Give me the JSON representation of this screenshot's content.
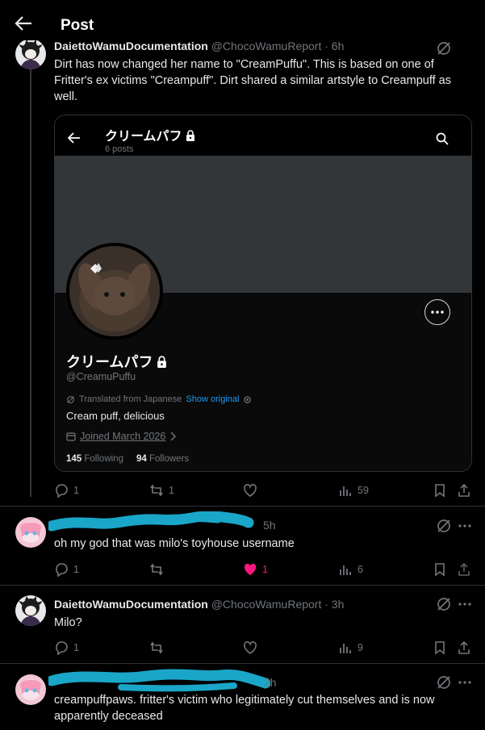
{
  "header": {
    "title": "Post"
  },
  "main_post": {
    "name": "DaiettoWamuDocumentation",
    "handle_time": "@ChocoWamuReport · 6h",
    "text": "Dirt has now changed her name to \"CreamPuffu\". This is based on one of Fritter's ex victims \"Creampuff\". Dirt shared a similar artstyle to Creampuff as well.",
    "embed": {
      "name": "クリームパフ",
      "posts": "6 posts",
      "display_name": "クリームパフ",
      "handle": "@CreamuPuffu",
      "translated": "Translated from Japanese",
      "show_original": "Show original",
      "bio": "Cream puff, delicious",
      "joined": "Joined March 2026",
      "following_count": "145",
      "following_label": "Following",
      "followers_count": "94",
      "followers_label": "Followers"
    },
    "replies": "1",
    "reposts": "1",
    "likes": "",
    "views": "59"
  },
  "reply1": {
    "handle_time": "5h",
    "text": "oh my god that was milo's toyhouse username",
    "replies": "1",
    "likes": "1",
    "views": "6"
  },
  "reply2": {
    "name": "DaiettoWamuDocumentation",
    "handle_time": "@ChocoWamuReport · 3h",
    "text": "Milo?",
    "replies": "1",
    "views": "9"
  },
  "reply3": {
    "handle_time": "2h",
    "text": "creampuffpaws. fritter's victim who legitimately cut themselves and is now apparently deceased"
  },
  "colors": {
    "accent": "#1d9bf0",
    "like": "#f91880",
    "redact": "#1aa6c8"
  }
}
